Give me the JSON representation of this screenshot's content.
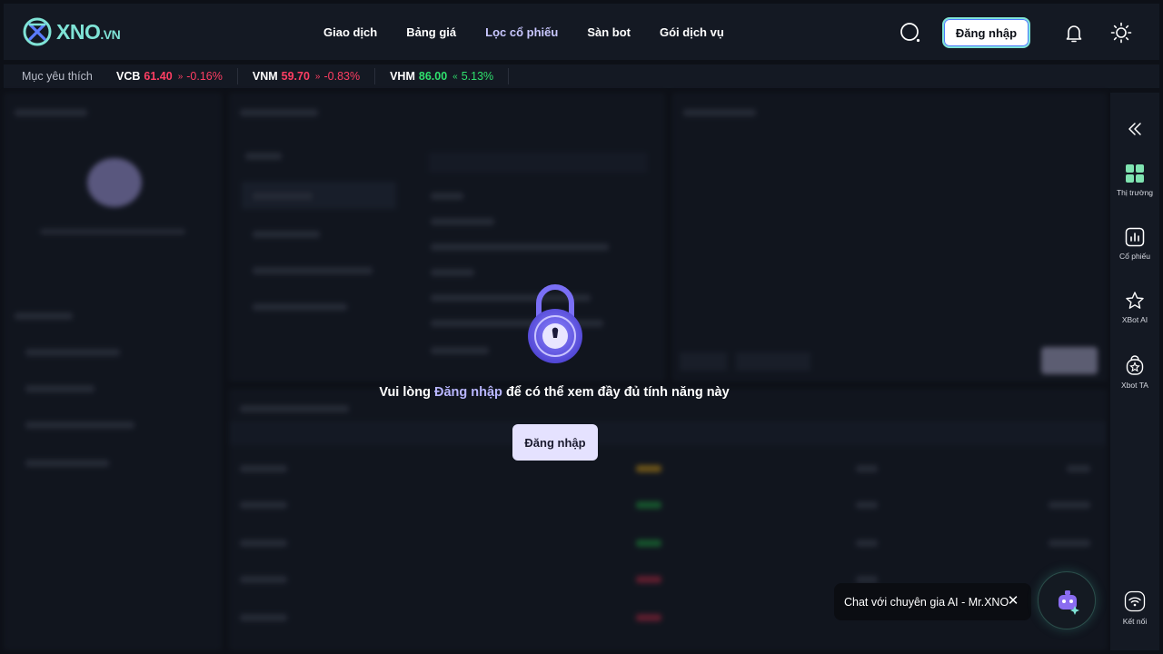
{
  "brand": {
    "name": "XNO",
    "suffix": ".VN"
  },
  "nav": [
    {
      "label": "Giao dịch",
      "active": false
    },
    {
      "label": "Bảng giá",
      "active": false
    },
    {
      "label": "Lọc cổ phiếu",
      "active": true
    },
    {
      "label": "Sàn bot",
      "active": false
    },
    {
      "label": "Gói dịch vụ",
      "active": false
    }
  ],
  "header": {
    "login_label": "Đăng nhập",
    "icons": [
      "search-icon",
      "bell-icon",
      "sun-icon"
    ]
  },
  "ticker": {
    "favorites_label": "Mục yêu thích",
    "items": [
      {
        "symbol": "VCB",
        "price": "61.40",
        "change": "-0.16%",
        "direction": "down"
      },
      {
        "symbol": "VNM",
        "price": "59.70",
        "change": "-0.83%",
        "direction": "down"
      },
      {
        "symbol": "VHM",
        "price": "86.00",
        "change": "5.13%",
        "direction": "up"
      }
    ]
  },
  "overlay": {
    "message_prefix": "Vui lòng ",
    "message_highlight": "Đăng nhập",
    "message_suffix": " để có thể xem đầy đủ tính năng này",
    "button_label": "Đăng nhập"
  },
  "right_sidebar": {
    "items": [
      {
        "label": "Thị trường",
        "icon": "grid-icon"
      },
      {
        "label": "Cổ phiếu",
        "icon": "chart-icon"
      },
      {
        "label": "XBot AI",
        "icon": "star-icon"
      },
      {
        "label": "Xbot TA",
        "icon": "bot-ta-icon"
      },
      {
        "label": "Kết nối",
        "icon": "wifi-icon"
      }
    ]
  },
  "chat": {
    "label": "Chat với chuyên gia AI - Mr.XNO",
    "close": "✕"
  },
  "colors": {
    "up": "#2fe06d",
    "down": "#ff3e63",
    "accent": "#b9b6ff",
    "brand": "#7fe3d6"
  }
}
